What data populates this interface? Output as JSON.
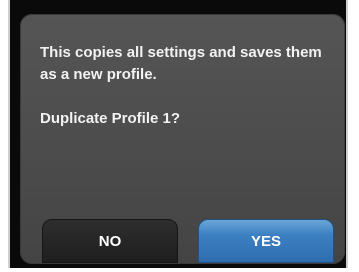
{
  "dialog": {
    "message": "This copies all settings and saves them as a new profile.",
    "question": "Duplicate Profile 1?",
    "buttons": {
      "no_label": "NO",
      "yes_label": "YES"
    }
  },
  "colors": {
    "dialog_background": "#4b4b4b",
    "text": "#f2f2f2",
    "no_button": "#262626",
    "yes_button": "#3c80c2"
  }
}
